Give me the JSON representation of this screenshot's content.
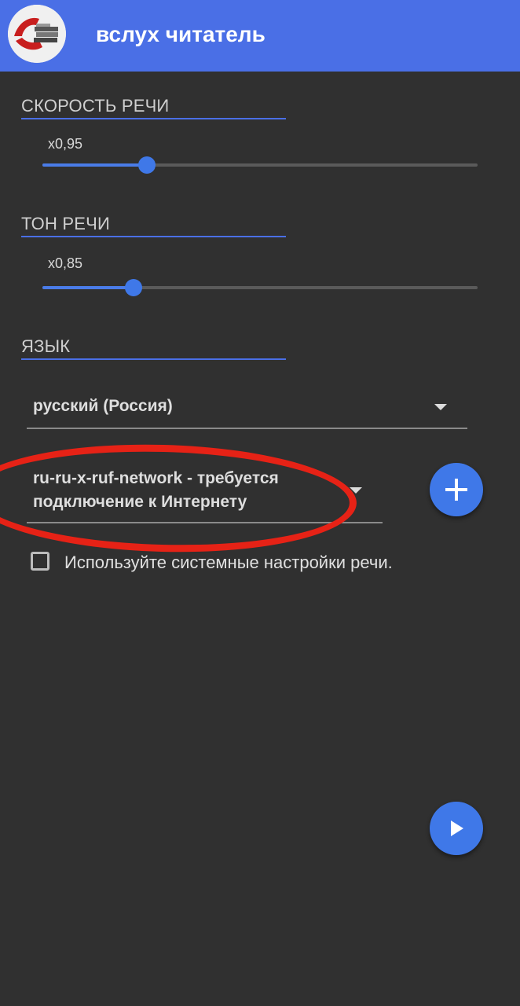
{
  "app": {
    "title": "вслух читатель",
    "logo_icon": "reader-logo-icon"
  },
  "speech_rate": {
    "title": "СКОРОСТЬ РЕЧИ",
    "value_label": "x0,95",
    "level": 0.24
  },
  "pitch": {
    "title": "ТОН РЕЧИ",
    "value_label": "x0,85",
    "level": 0.21
  },
  "language": {
    "title": "ЯЗЫК",
    "selected_language": "русский (Россия)",
    "selected_voice_line1": "ru-ru-x-ruf-network - требуется",
    "selected_voice_line2": "подключение к Интернету"
  },
  "system_settings": {
    "label": "Используйте системные настройки речи.",
    "checked": false
  },
  "colors": {
    "accent": "#4a6fe6",
    "background": "#303030",
    "annotation": "#e62216"
  },
  "icons": {
    "add": "plus-icon",
    "play": "play-icon",
    "dropdown": "caret-down-icon"
  }
}
